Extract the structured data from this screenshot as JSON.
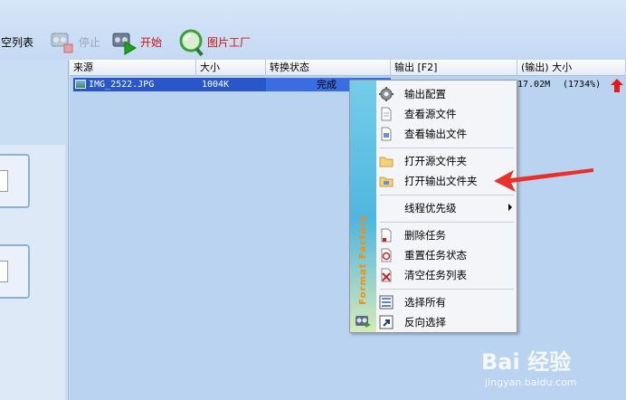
{
  "toolbar": {
    "clear_label": "空列表",
    "stop_label": "停止",
    "start_label": "开始",
    "picture_factory_label": "图片工厂"
  },
  "list": {
    "headers": [
      "来源",
      "大小",
      "转换状态",
      "输出 [F2]",
      "(输出) 大小"
    ],
    "rows": [
      {
        "source": "IMG_2522.JPG",
        "size": "1004K",
        "status": "完成",
        "progress_fraction": 1.0,
        "output_size": "17.02M",
        "ratio": "(1734%)"
      }
    ]
  },
  "context_menu": {
    "brand": "Format Factory",
    "items": [
      {
        "label": "输出配置",
        "icon": "gear-icon"
      },
      {
        "label": "查看源文件",
        "icon": "document-icon"
      },
      {
        "label": "查看输出文件",
        "icon": "document-output-icon"
      },
      {
        "label": "打开源文件夹",
        "icon": "folder-icon"
      },
      {
        "label": "打开输出文件夹",
        "icon": "folder-output-icon"
      },
      {
        "label": "线程优先级",
        "icon": "none"
      },
      {
        "label": "删除任务",
        "icon": "delete-document-icon"
      },
      {
        "label": "重置任务状态",
        "icon": "reset-icon"
      },
      {
        "label": "清空任务列表",
        "icon": "clear-list-icon"
      },
      {
        "label": "选择所有",
        "icon": "select-all-icon"
      },
      {
        "label": "反向选择",
        "icon": "invert-selection-icon"
      }
    ]
  },
  "watermark": {
    "main": "Bai 经验",
    "sub": "jingyan.baidu.com"
  },
  "colors": {
    "selection": "#2a57c7",
    "annotation_arrow": "#e8302c",
    "start_label": "#d01010"
  }
}
